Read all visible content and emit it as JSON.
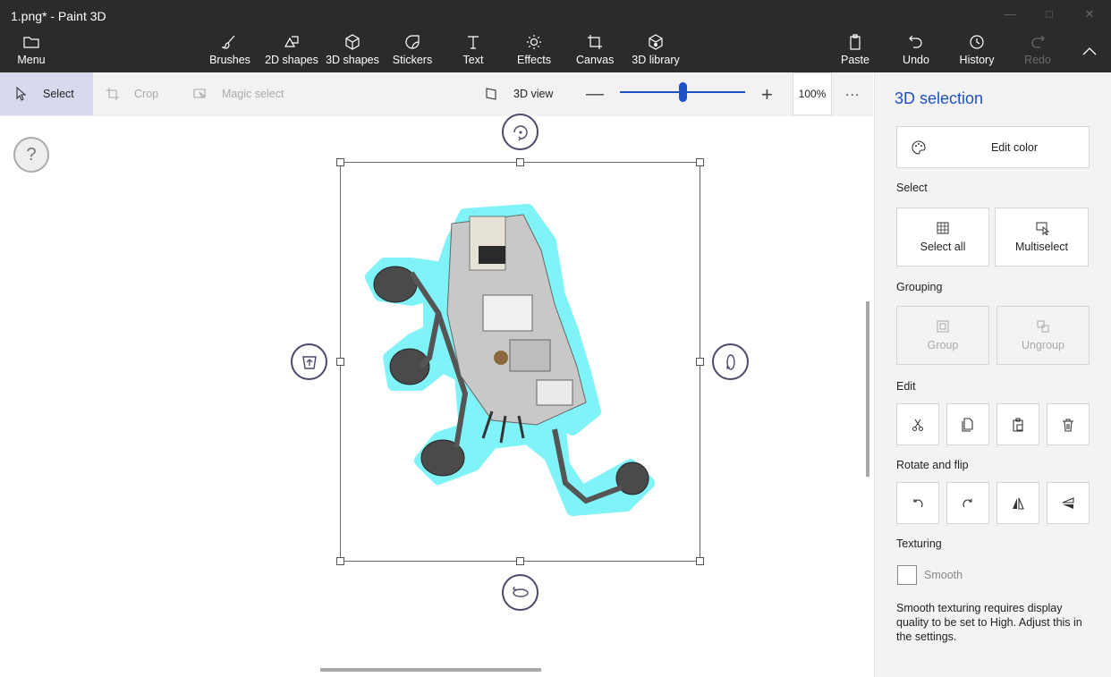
{
  "window": {
    "title": "1.png* - Paint 3D"
  },
  "ribbon": {
    "menu": "Menu",
    "brushes": "Brushes",
    "shapes2d": "2D shapes",
    "shapes3d": "3D shapes",
    "stickers": "Stickers",
    "text": "Text",
    "effects": "Effects",
    "canvas": "Canvas",
    "library3d": "3D library",
    "paste": "Paste",
    "undo": "Undo",
    "history": "History",
    "redo": "Redo"
  },
  "toolbar": {
    "select": "Select",
    "crop": "Crop",
    "magic_select": "Magic select",
    "view3d": "3D view",
    "zoom": "100%",
    "zoom_level": 0.5,
    "more": "..."
  },
  "canvas": {
    "help": "?"
  },
  "panel": {
    "title": "3D selection",
    "edit_color": "Edit color",
    "select_section": "Select",
    "select_all": "Select all",
    "multiselect": "Multiselect",
    "grouping_section": "Grouping",
    "group": "Group",
    "ungroup": "Ungroup",
    "edit_section": "Edit",
    "rotate_section": "Rotate and flip",
    "texturing_section": "Texturing",
    "smooth": "Smooth",
    "smooth_note": "Smooth texturing requires display quality to be set to High. Adjust this in the settings."
  },
  "colors": {
    "accent": "#2050c0",
    "ribbon": "#2b2b2b",
    "selection_glow": "#7ff3f7"
  }
}
